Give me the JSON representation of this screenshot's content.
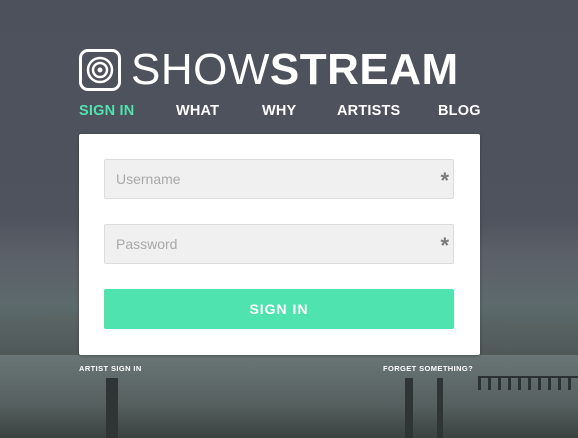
{
  "brand": {
    "name_light": "SHOW",
    "name_bold": "STREAM",
    "icon": "speaker-icon"
  },
  "nav": {
    "items": [
      {
        "label": "SIGN IN",
        "active": true
      },
      {
        "label": "WHAT",
        "active": false
      },
      {
        "label": "WHY",
        "active": false
      },
      {
        "label": "ARTISTS",
        "active": false
      },
      {
        "label": "BLOG",
        "active": false
      }
    ]
  },
  "form": {
    "username": {
      "placeholder": "Username",
      "value": "",
      "required_marker": "*"
    },
    "password": {
      "placeholder": "Password",
      "value": "",
      "required_marker": "*"
    },
    "submit_label": "SIGN IN"
  },
  "footer": {
    "artist_sign_in": "ARTIST SIGN IN",
    "forgot": "FORGET SOMETHING?"
  },
  "colors": {
    "accent": "#4fe3b0",
    "card": "#ffffff",
    "field_bg": "#f0f0f0"
  }
}
